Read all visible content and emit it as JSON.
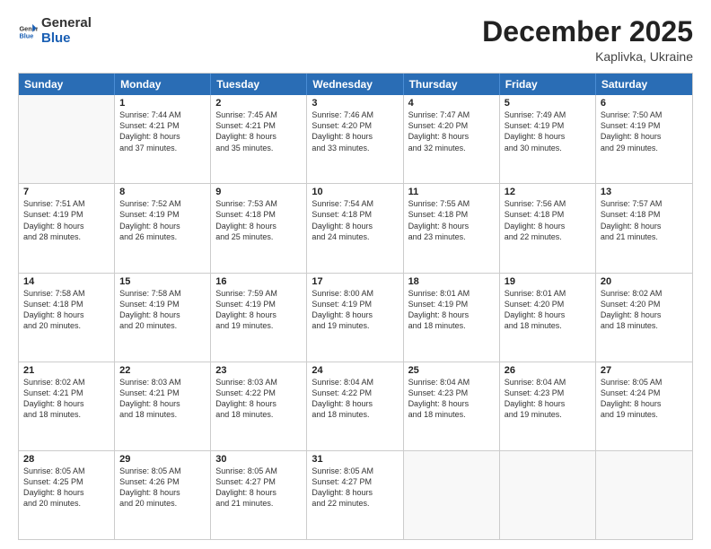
{
  "logo": {
    "general": "General",
    "blue": "Blue"
  },
  "title": "December 2025",
  "location": "Kaplivka, Ukraine",
  "header_days": [
    "Sunday",
    "Monday",
    "Tuesday",
    "Wednesday",
    "Thursday",
    "Friday",
    "Saturday"
  ],
  "rows": [
    [
      {
        "day": "",
        "info": ""
      },
      {
        "day": "1",
        "info": "Sunrise: 7:44 AM\nSunset: 4:21 PM\nDaylight: 8 hours\nand 37 minutes."
      },
      {
        "day": "2",
        "info": "Sunrise: 7:45 AM\nSunset: 4:21 PM\nDaylight: 8 hours\nand 35 minutes."
      },
      {
        "day": "3",
        "info": "Sunrise: 7:46 AM\nSunset: 4:20 PM\nDaylight: 8 hours\nand 33 minutes."
      },
      {
        "day": "4",
        "info": "Sunrise: 7:47 AM\nSunset: 4:20 PM\nDaylight: 8 hours\nand 32 minutes."
      },
      {
        "day": "5",
        "info": "Sunrise: 7:49 AM\nSunset: 4:19 PM\nDaylight: 8 hours\nand 30 minutes."
      },
      {
        "day": "6",
        "info": "Sunrise: 7:50 AM\nSunset: 4:19 PM\nDaylight: 8 hours\nand 29 minutes."
      }
    ],
    [
      {
        "day": "7",
        "info": "Sunrise: 7:51 AM\nSunset: 4:19 PM\nDaylight: 8 hours\nand 28 minutes."
      },
      {
        "day": "8",
        "info": "Sunrise: 7:52 AM\nSunset: 4:19 PM\nDaylight: 8 hours\nand 26 minutes."
      },
      {
        "day": "9",
        "info": "Sunrise: 7:53 AM\nSunset: 4:18 PM\nDaylight: 8 hours\nand 25 minutes."
      },
      {
        "day": "10",
        "info": "Sunrise: 7:54 AM\nSunset: 4:18 PM\nDaylight: 8 hours\nand 24 minutes."
      },
      {
        "day": "11",
        "info": "Sunrise: 7:55 AM\nSunset: 4:18 PM\nDaylight: 8 hours\nand 23 minutes."
      },
      {
        "day": "12",
        "info": "Sunrise: 7:56 AM\nSunset: 4:18 PM\nDaylight: 8 hours\nand 22 minutes."
      },
      {
        "day": "13",
        "info": "Sunrise: 7:57 AM\nSunset: 4:18 PM\nDaylight: 8 hours\nand 21 minutes."
      }
    ],
    [
      {
        "day": "14",
        "info": "Sunrise: 7:58 AM\nSunset: 4:18 PM\nDaylight: 8 hours\nand 20 minutes."
      },
      {
        "day": "15",
        "info": "Sunrise: 7:58 AM\nSunset: 4:19 PM\nDaylight: 8 hours\nand 20 minutes."
      },
      {
        "day": "16",
        "info": "Sunrise: 7:59 AM\nSunset: 4:19 PM\nDaylight: 8 hours\nand 19 minutes."
      },
      {
        "day": "17",
        "info": "Sunrise: 8:00 AM\nSunset: 4:19 PM\nDaylight: 8 hours\nand 19 minutes."
      },
      {
        "day": "18",
        "info": "Sunrise: 8:01 AM\nSunset: 4:19 PM\nDaylight: 8 hours\nand 18 minutes."
      },
      {
        "day": "19",
        "info": "Sunrise: 8:01 AM\nSunset: 4:20 PM\nDaylight: 8 hours\nand 18 minutes."
      },
      {
        "day": "20",
        "info": "Sunrise: 8:02 AM\nSunset: 4:20 PM\nDaylight: 8 hours\nand 18 minutes."
      }
    ],
    [
      {
        "day": "21",
        "info": "Sunrise: 8:02 AM\nSunset: 4:21 PM\nDaylight: 8 hours\nand 18 minutes."
      },
      {
        "day": "22",
        "info": "Sunrise: 8:03 AM\nSunset: 4:21 PM\nDaylight: 8 hours\nand 18 minutes."
      },
      {
        "day": "23",
        "info": "Sunrise: 8:03 AM\nSunset: 4:22 PM\nDaylight: 8 hours\nand 18 minutes."
      },
      {
        "day": "24",
        "info": "Sunrise: 8:04 AM\nSunset: 4:22 PM\nDaylight: 8 hours\nand 18 minutes."
      },
      {
        "day": "25",
        "info": "Sunrise: 8:04 AM\nSunset: 4:23 PM\nDaylight: 8 hours\nand 18 minutes."
      },
      {
        "day": "26",
        "info": "Sunrise: 8:04 AM\nSunset: 4:23 PM\nDaylight: 8 hours\nand 19 minutes."
      },
      {
        "day": "27",
        "info": "Sunrise: 8:05 AM\nSunset: 4:24 PM\nDaylight: 8 hours\nand 19 minutes."
      }
    ],
    [
      {
        "day": "28",
        "info": "Sunrise: 8:05 AM\nSunset: 4:25 PM\nDaylight: 8 hours\nand 20 minutes."
      },
      {
        "day": "29",
        "info": "Sunrise: 8:05 AM\nSunset: 4:26 PM\nDaylight: 8 hours\nand 20 minutes."
      },
      {
        "day": "30",
        "info": "Sunrise: 8:05 AM\nSunset: 4:27 PM\nDaylight: 8 hours\nand 21 minutes."
      },
      {
        "day": "31",
        "info": "Sunrise: 8:05 AM\nSunset: 4:27 PM\nDaylight: 8 hours\nand 22 minutes."
      },
      {
        "day": "",
        "info": ""
      },
      {
        "day": "",
        "info": ""
      },
      {
        "day": "",
        "info": ""
      }
    ]
  ]
}
